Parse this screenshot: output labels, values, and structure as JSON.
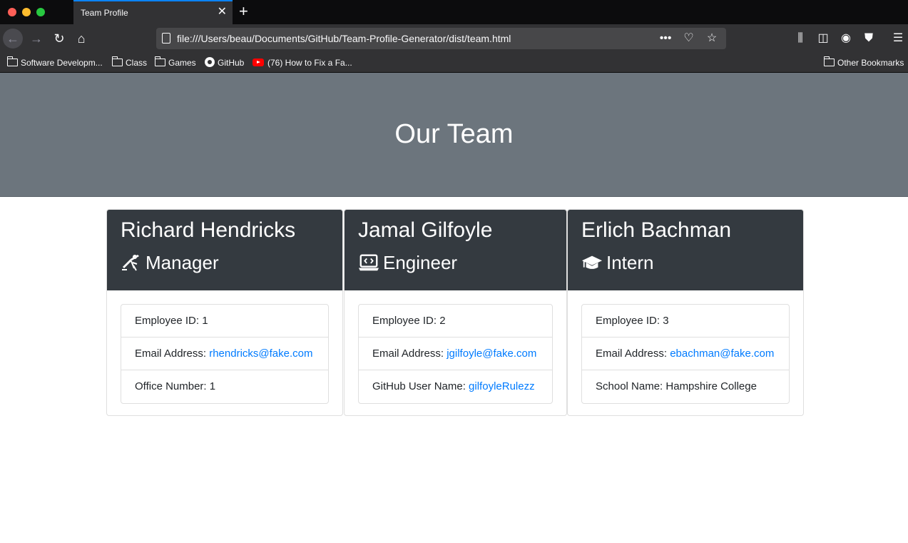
{
  "browser": {
    "tab_title": "Team Profile",
    "tab_close": "✕",
    "new_tab": "+",
    "url": "file:///Users/beau/Documents/GitHub/Team-Profile-Generator/dist/team.html",
    "url_more": "•••",
    "bookmarks": [
      {
        "label": "Software Developm...",
        "icon": "folder-icon"
      },
      {
        "label": "Class",
        "icon": "folder-icon"
      },
      {
        "label": "Games",
        "icon": "folder-icon"
      },
      {
        "label": "GitHub",
        "icon": "github-icon"
      },
      {
        "label": "(76) How to Fix a Fa...",
        "icon": "youtube-icon"
      },
      {
        "label": "Other Bookmarks",
        "icon": "folder-icon"
      }
    ]
  },
  "page": {
    "title": "Our Team",
    "cards": [
      {
        "name": "Richard Hendricks",
        "role": "Manager",
        "role_icon": "mug-icon",
        "id_label": "Employee ID: ",
        "id_value": "1",
        "email_label": "Email Address: ",
        "email": "rhendricks@fake.com",
        "extra_label": "Office Number: ",
        "extra_value": "1"
      },
      {
        "name": "Jamal Gilfoyle",
        "role": "Engineer",
        "role_icon": "laptop-code-icon",
        "id_label": "Employee ID: ",
        "id_value": "2",
        "email_label": "Email Address: ",
        "email": "jgilfoyle@fake.com",
        "extra_label": "GitHub User Name: ",
        "extra_value": "gilfoyleRulezz"
      },
      {
        "name": "Erlich Bachman",
        "role": "Intern",
        "role_icon": "graduation-cap-icon",
        "id_label": "Employee ID: ",
        "id_value": "3",
        "email_label": "Email Address: ",
        "email": "ebachman@fake.com",
        "extra_label": "School Name: ",
        "extra_value": "Hampshire College"
      }
    ]
  },
  "colors": {
    "jumbotron": "#6c757d",
    "card_header": "#343a40",
    "link": "#007bff"
  }
}
